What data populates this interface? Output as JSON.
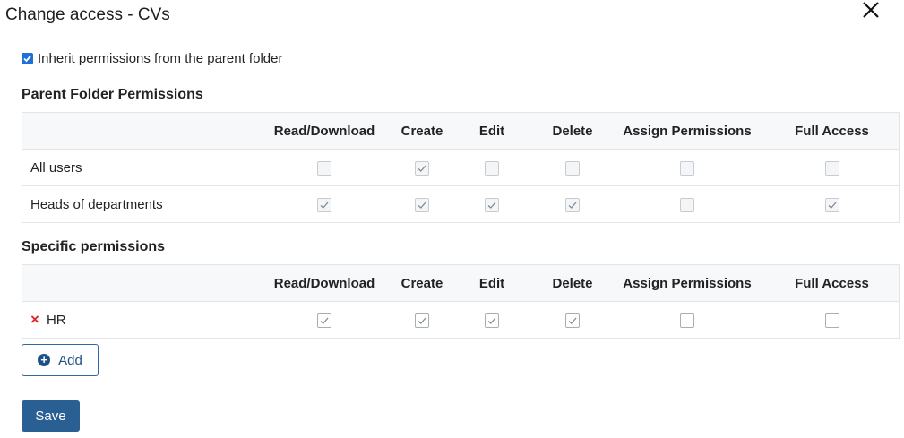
{
  "dialog": {
    "title": "Change access - CVs",
    "inherit_label": "Inherit permissions from the parent folder",
    "inherit_checked": true
  },
  "columns": [
    "Read/Download",
    "Create",
    "Edit",
    "Delete",
    "Assign Permissions",
    "Full Access"
  ],
  "parent_section": {
    "title": "Parent Folder Permissions",
    "rows": [
      {
        "name": "All users",
        "values": [
          false,
          true,
          false,
          false,
          false,
          false
        ]
      },
      {
        "name": "Heads of departments",
        "values": [
          true,
          true,
          true,
          true,
          false,
          true
        ]
      }
    ]
  },
  "specific_section": {
    "title": "Specific permissions",
    "rows": [
      {
        "name": "HR",
        "values": [
          true,
          true,
          true,
          true,
          false,
          false
        ]
      }
    ]
  },
  "buttons": {
    "add_label": "Add",
    "save_label": "Save"
  },
  "icons": {
    "close": "close-icon",
    "remove": "remove-x-icon",
    "add": "plus-circle-icon"
  },
  "colors": {
    "primary": "#2a5f93",
    "checkbox_blue": "#1e6fd9",
    "remove_red": "#e02424"
  }
}
